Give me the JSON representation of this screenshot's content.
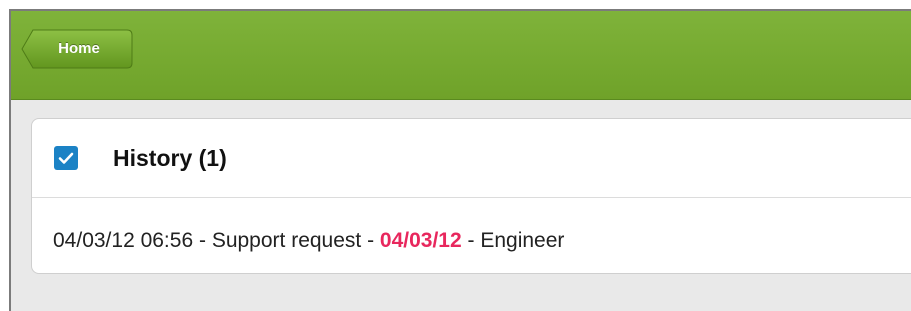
{
  "topbar": {
    "home_label": "Home",
    "color": "#73a72d"
  },
  "history": {
    "title": "History (1)",
    "checkbox_icon": "check-icon",
    "accent": "#1b82c5",
    "entries": [
      {
        "datetime": "04/03/12 06:56",
        "sep1": " - ",
        "type": "Support request",
        "sep2": " - ",
        "date": "04/03/12",
        "sep3": " - ",
        "role": "Engineer",
        "date_color": "#e8275d"
      }
    ]
  }
}
